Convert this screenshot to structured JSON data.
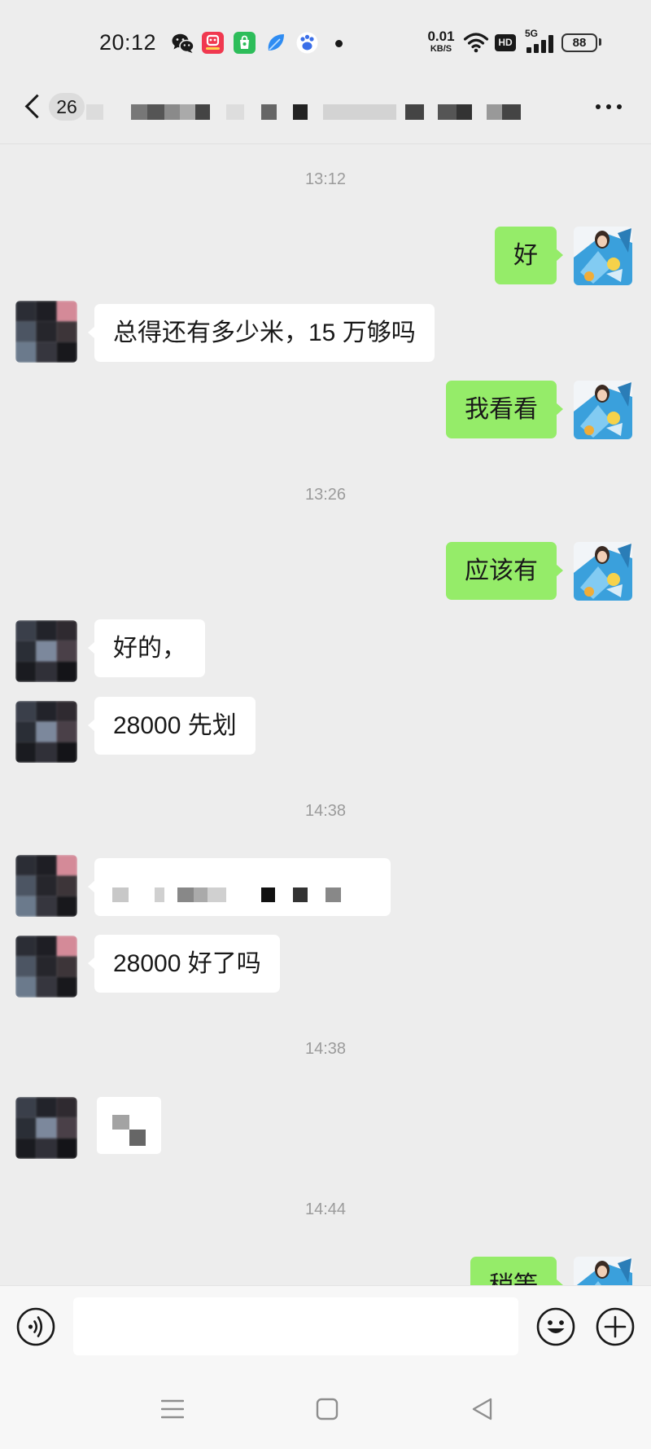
{
  "status_bar": {
    "time": "20:12",
    "app_icons": [
      "wechat-icon",
      "red-app-icon",
      "green-app-icon",
      "blue-leaf-app-icon",
      "baidu-app-icon",
      "notification-dot-icon"
    ],
    "net_speed": {
      "value": "0.01",
      "unit": "KB/S"
    },
    "wifi_icon": "wifi-icon",
    "hd_label": "HD",
    "network_type": "5G",
    "signal_icon": "signal-bars-icon",
    "battery_level": "88"
  },
  "header": {
    "back_icon": "chevron-left-icon",
    "unread_count": "26",
    "more_icon": "more-dots-icon"
  },
  "chat": {
    "timestamps": [
      "13:12",
      "13:26",
      "14:38",
      "14:38",
      "14:44"
    ],
    "messages": [
      {
        "from_me": true,
        "text": "好"
      },
      {
        "from_me": false,
        "text": "总得还有多少米，15 万够吗"
      },
      {
        "from_me": true,
        "text": "我看看"
      },
      {
        "from_me": true,
        "text": "应该有"
      },
      {
        "from_me": false,
        "text": "好的，"
      },
      {
        "from_me": false,
        "text": "28000 先划"
      },
      {
        "from_me": false
      },
      {
        "from_me": false,
        "text": "28000 好了吗"
      },
      {
        "from_me": false,
        "is_image": true
      },
      {
        "from_me": true,
        "text": "稍等"
      }
    ]
  },
  "input_bar": {
    "voice_icon": "voice-mode-icon",
    "message_input_value": "",
    "emoji_icon": "emoji-icon",
    "plus_icon": "plus-icon"
  },
  "nav_bar": {
    "icons": [
      "menu-icon",
      "home-square-icon",
      "back-triangle-icon"
    ]
  },
  "colors": {
    "chat_background": "#ededed",
    "sent_bubble": "#95ec69",
    "received_bubble": "#ffffff",
    "timestamp_text": "#9b9b9b",
    "input_bar_background": "#f7f7f7"
  }
}
